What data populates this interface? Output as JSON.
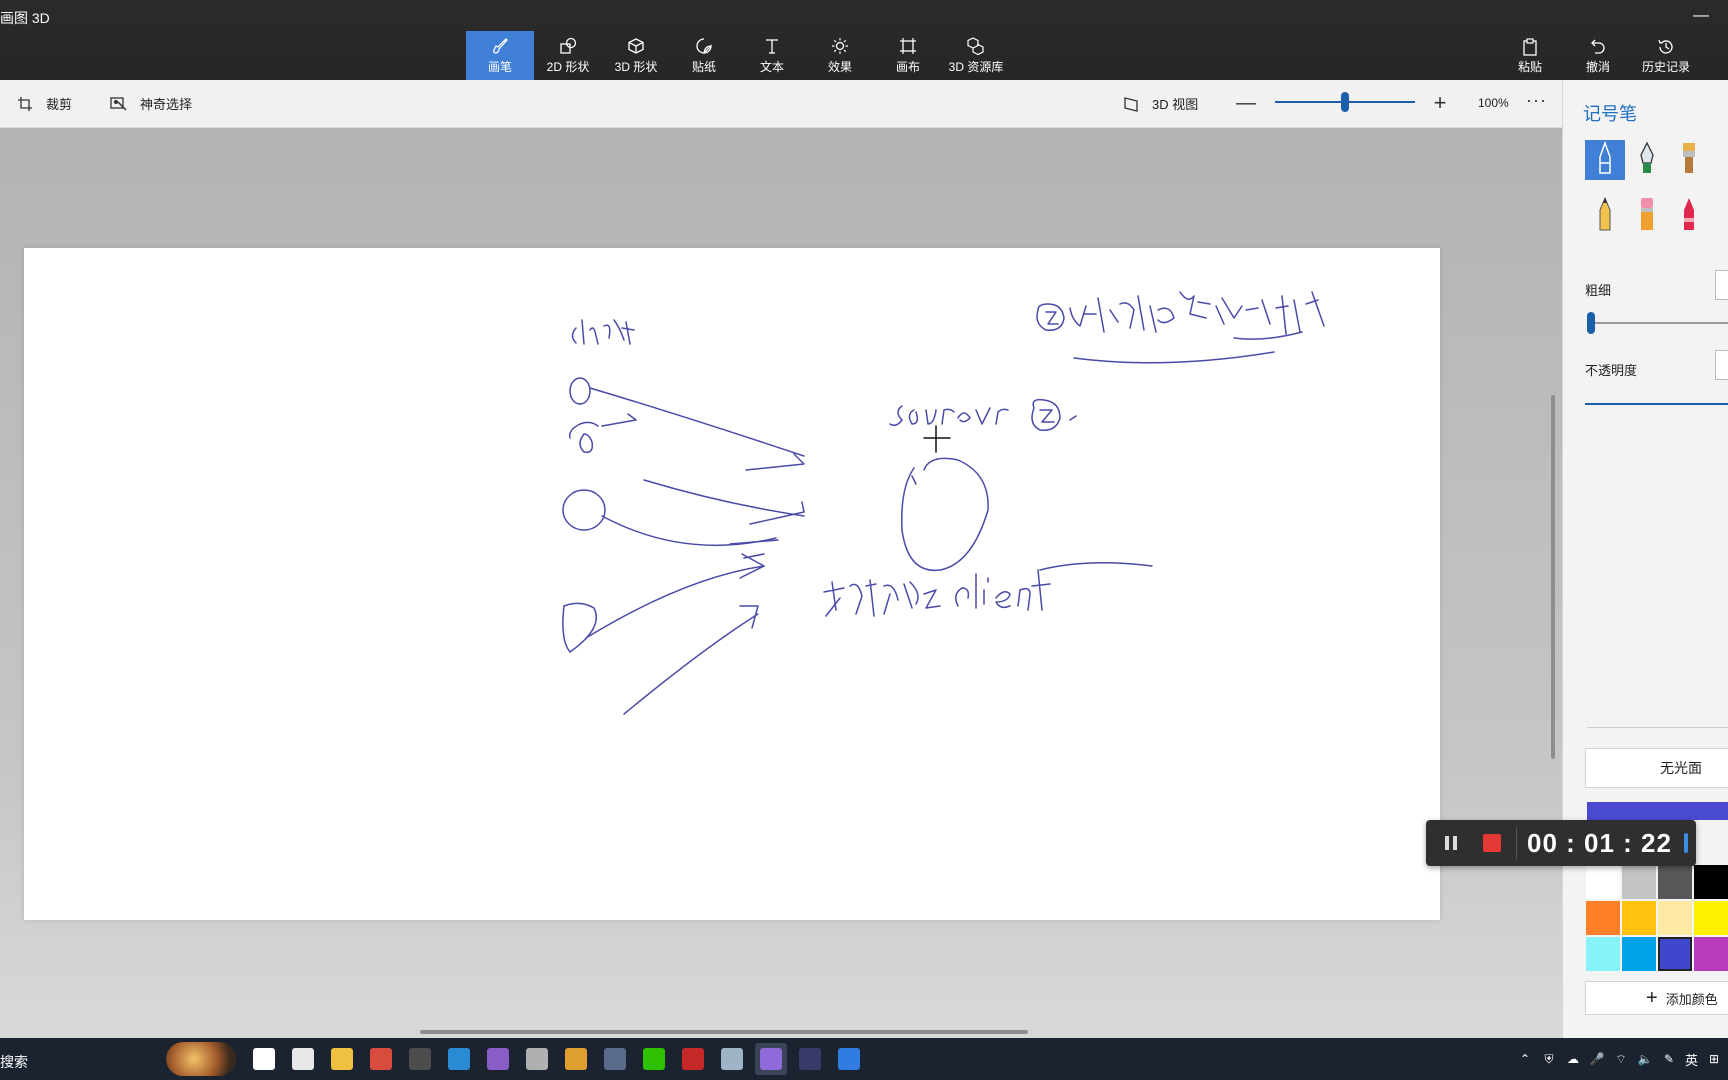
{
  "app": {
    "title": "画图 3D"
  },
  "toolbar": {
    "tabs": [
      {
        "label": "画笔",
        "icon": "brush-icon",
        "active": true
      },
      {
        "label": "2D 形状",
        "icon": "2d-shapes-icon",
        "active": false
      },
      {
        "label": "3D 形状",
        "icon": "3d-shapes-icon",
        "active": false
      },
      {
        "label": "贴纸",
        "icon": "stickers-icon",
        "active": false
      },
      {
        "label": "文本",
        "icon": "text-icon",
        "active": false
      },
      {
        "label": "效果",
        "icon": "effects-icon",
        "active": false
      },
      {
        "label": "画布",
        "icon": "canvas-icon",
        "active": false
      },
      {
        "label": "3D 资源库",
        "icon": "3d-library-icon",
        "active": false
      }
    ],
    "right": [
      {
        "label": "粘贴",
        "icon": "paste-icon"
      },
      {
        "label": "撤消",
        "icon": "undo-icon"
      },
      {
        "label": "历史记录",
        "icon": "history-icon"
      }
    ]
  },
  "commandbar": {
    "crop": "裁剪",
    "magic_select": "神奇选择",
    "view3d": "3D 视图",
    "zoom_minus": "—",
    "zoom_plus": "+",
    "zoom_percent": "100%",
    "zoom_level": 0.5,
    "more": "···"
  },
  "panel": {
    "title": "记号笔",
    "brushes": [
      "marker-icon",
      "calligraphy-pen-icon",
      "oil-brush-icon",
      "pencil-icon",
      "eraser-icon",
      "crayon-icon"
    ],
    "thickness_label": "粗细",
    "opacity_label": "不透明度",
    "finish": "无光面",
    "current_color": "#4a4ad1",
    "palette": [
      "#ffffff",
      "#c3c3c3",
      "#585858",
      "#000000",
      "#ff7f27",
      "#ffc20e",
      "#fde9a1",
      "#fff200",
      "#85f3f9",
      "#00a2e8",
      "#3f48cc",
      "#b83dba"
    ],
    "selected_swatch": 10,
    "add_color": "添加颜色"
  },
  "recorder": {
    "time": "00 : 01 : 22"
  },
  "taskbar": {
    "search": "搜索",
    "apps": [
      {
        "name": "task-view-icon",
        "color": "#ffffff"
      },
      {
        "name": "store-icon",
        "color": "#e8e8e8"
      },
      {
        "name": "file-explorer-icon",
        "color": "#f0c040"
      },
      {
        "name": "chrome-icon",
        "color": "#d94c3d"
      },
      {
        "name": "sublime-icon",
        "color": "#4c4c4c"
      },
      {
        "name": "vscode-icon",
        "color": "#2a8ad4"
      },
      {
        "name": "visual-studio-icon",
        "color": "#8a5cc7"
      },
      {
        "name": "app-icon",
        "color": "#b0b0b0"
      },
      {
        "name": "vmware-icon",
        "color": "#e0a030"
      },
      {
        "name": "calculator-icon",
        "color": "#5a6a8a"
      },
      {
        "name": "wechat-icon",
        "color": "#2dc100"
      },
      {
        "name": "recorder-icon",
        "color": "#c62828"
      },
      {
        "name": "photos-icon",
        "color": "#a0b4c8"
      },
      {
        "name": "paint3d-icon",
        "color": "#8e6bd8"
      },
      {
        "name": "terminal-icon",
        "color": "#3a3a6a"
      },
      {
        "name": "feishu-icon",
        "color": "#2f7de1"
      }
    ],
    "active_app": 13,
    "ime": "英"
  }
}
